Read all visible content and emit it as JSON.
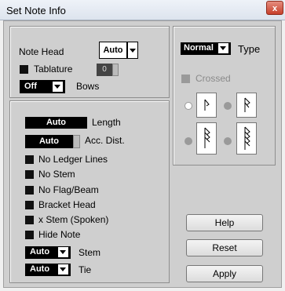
{
  "window": {
    "title": "Set Note Info",
    "close_glyph": "x"
  },
  "note_head": {
    "label": "Note Head",
    "value": "Auto"
  },
  "tablature": {
    "label": "Tablature",
    "value": "0"
  },
  "bows": {
    "label": "Bows",
    "value": "Off"
  },
  "type": {
    "label": "Type",
    "value": "Normal"
  },
  "crossed": {
    "label": "Crossed"
  },
  "length": {
    "label": "Length",
    "value": "Auto"
  },
  "acc_dist": {
    "label": "Acc. Dist.",
    "value": "Auto"
  },
  "checkboxes": [
    {
      "label": "No Ledger Lines"
    },
    {
      "label": "No Stem"
    },
    {
      "label": "No Flag/Beam"
    },
    {
      "label": "Bracket Head"
    },
    {
      "label": "x Stem (Spoken)"
    },
    {
      "label": "Hide Note"
    }
  ],
  "stem": {
    "label": "Stem",
    "value": "Auto"
  },
  "tie": {
    "label": "Tie",
    "value": "Auto"
  },
  "buttons": {
    "help": "Help",
    "reset": "Reset",
    "apply": "Apply"
  }
}
